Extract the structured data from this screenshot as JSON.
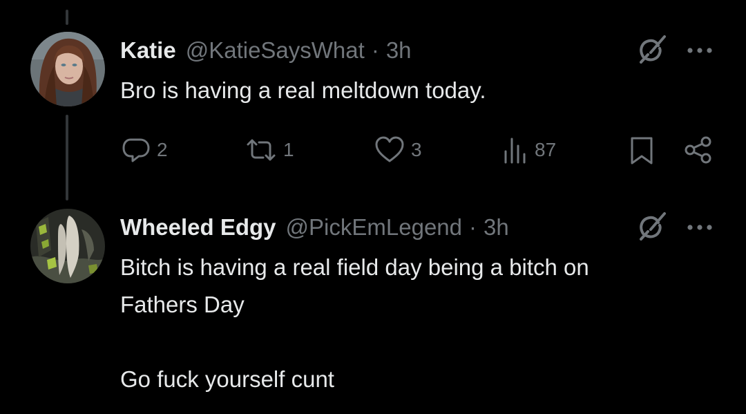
{
  "colors": {
    "background": "#000000",
    "primary_text": "#e7e9ea",
    "secondary_text": "#71767b",
    "thread_line": "#333639"
  },
  "tweets": [
    {
      "display_name": "Katie",
      "handle": "@KatieSaysWhat",
      "separator": "·",
      "time": "3h",
      "text_lines": [
        "Bro is having a real meltdown today."
      ],
      "actions": {
        "reply_count": "2",
        "retweet_count": "1",
        "like_count": "3",
        "views_count": "87"
      },
      "icons": [
        "grok-icon",
        "more-icon",
        "reply-icon",
        "retweet-icon",
        "like-icon",
        "views-icon",
        "bookmark-icon",
        "share-icon"
      ]
    },
    {
      "display_name": "Wheeled Edgy",
      "handle": "@PickEmLegend",
      "separator": "·",
      "time": "3h",
      "text_lines": [
        "Bitch is having a real field day being a bitch on",
        "Fathers Day",
        "Go fuck yourself cunt"
      ],
      "icons": [
        "grok-icon",
        "more-icon"
      ]
    }
  ]
}
